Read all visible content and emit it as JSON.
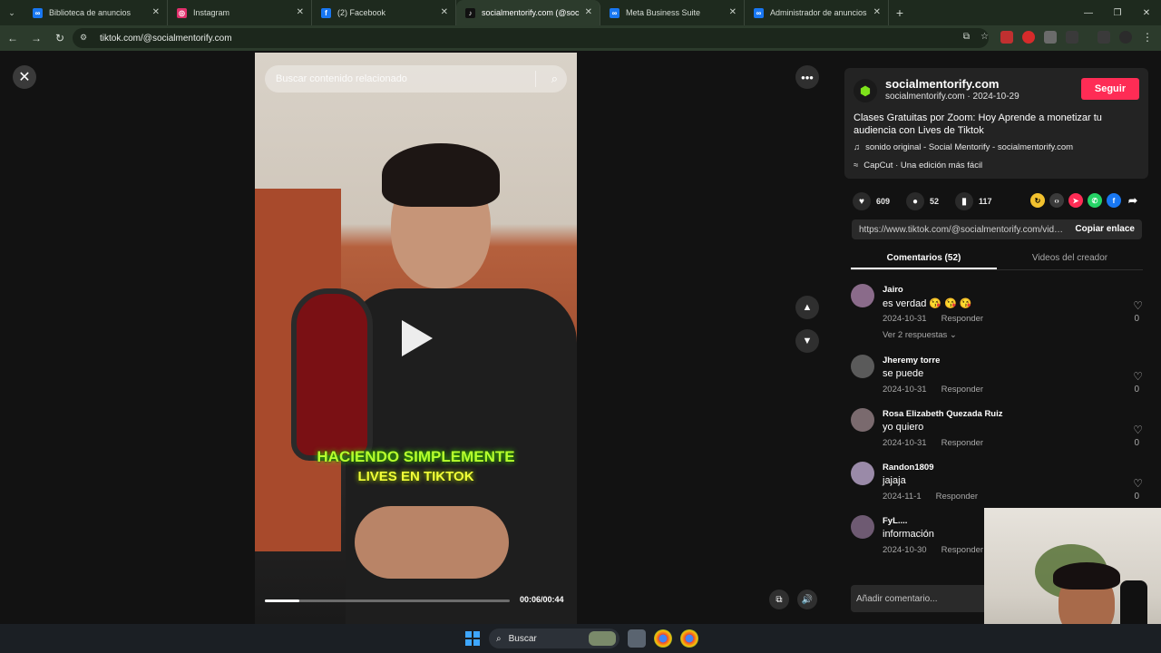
{
  "tabs": [
    {
      "title": "Biblioteca de anuncios",
      "favicon": "meta-icon",
      "color": "#1877f2",
      "glyph": "∞",
      "active": false
    },
    {
      "title": "Instagram",
      "favicon": "instagram-icon",
      "color": "#e1306c",
      "glyph": "◎",
      "active": false
    },
    {
      "title": "(2) Facebook",
      "favicon": "facebook-icon",
      "color": "#1877f2",
      "glyph": "f",
      "active": false
    },
    {
      "title": "socialmentorify.com (@socialme",
      "favicon": "tiktok-icon",
      "color": "#111111",
      "glyph": "♪",
      "active": true
    },
    {
      "title": "Meta Business Suite",
      "favicon": "meta-icon",
      "color": "#1877f2",
      "glyph": "∞",
      "active": false
    },
    {
      "title": "Administrador de anuncios - Ad",
      "favicon": "meta-icon",
      "color": "#1877f2",
      "glyph": "∞",
      "active": false
    }
  ],
  "toolbar": {
    "url": "tiktok.com/@socialmentorify.com"
  },
  "video": {
    "search_placeholder": "Buscar contenido relacionado",
    "caption_line1": "HACIENDO SIMPLEMENTE",
    "caption_line2": "LIVES EN TIKTOK",
    "time": "00:06/00:44",
    "progress": 0.14
  },
  "panel": {
    "username": "socialmentorify.com",
    "handle_date": "socialmentorify.com · 2024-10-29",
    "follow_label": "Seguir",
    "description": "Clases Gratuitas por Zoom: Hoy Aprende a monetizar tu audiencia con Lives de Tiktok",
    "music": "sonido original - Social Mentorify - socialmentorify.com",
    "capcut": "CapCut · Una edición más fácil",
    "likes": "609",
    "comments": "52",
    "saves": "117",
    "link": "https://www.tiktok.com/@socialmentorify.com/video/",
    "copy_label": "Copiar enlace",
    "tab_comments": "Comentarios (52)",
    "tab_videos": "Videos del creador",
    "comment_placeholder": "Añadir comentario..."
  },
  "comment_list": [
    {
      "name": "Jairo",
      "text": "es verdad 😘 😘 😘",
      "date": "2024-10-31",
      "reply": "Responder",
      "likes": "0",
      "more": "Ver 2 respuestas ⌄",
      "avatar_color": "#8a6b8a"
    },
    {
      "name": "Jheremy torre",
      "text": "se puede",
      "date": "2024-10-31",
      "reply": "Responder",
      "likes": "0",
      "avatar_color": "#5a5a5a"
    },
    {
      "name": "Rosa Elizabeth Quezada Ruiz",
      "text": "yo quiero",
      "date": "2024-10-31",
      "reply": "Responder",
      "likes": "0",
      "avatar_color": "#7a6a6e"
    },
    {
      "name": "Randon1809",
      "text": "jajaja",
      "date": "2024-11-1",
      "reply": "Responder",
      "likes": "0",
      "avatar_color": "#9a8aa8"
    },
    {
      "name": "FyL....",
      "text": "información",
      "date": "2024-10-30",
      "reply": "Responder",
      "likes": "0",
      "avatar_color": "#6e5a72"
    }
  ],
  "taskbar": {
    "search_label": "Buscar"
  }
}
